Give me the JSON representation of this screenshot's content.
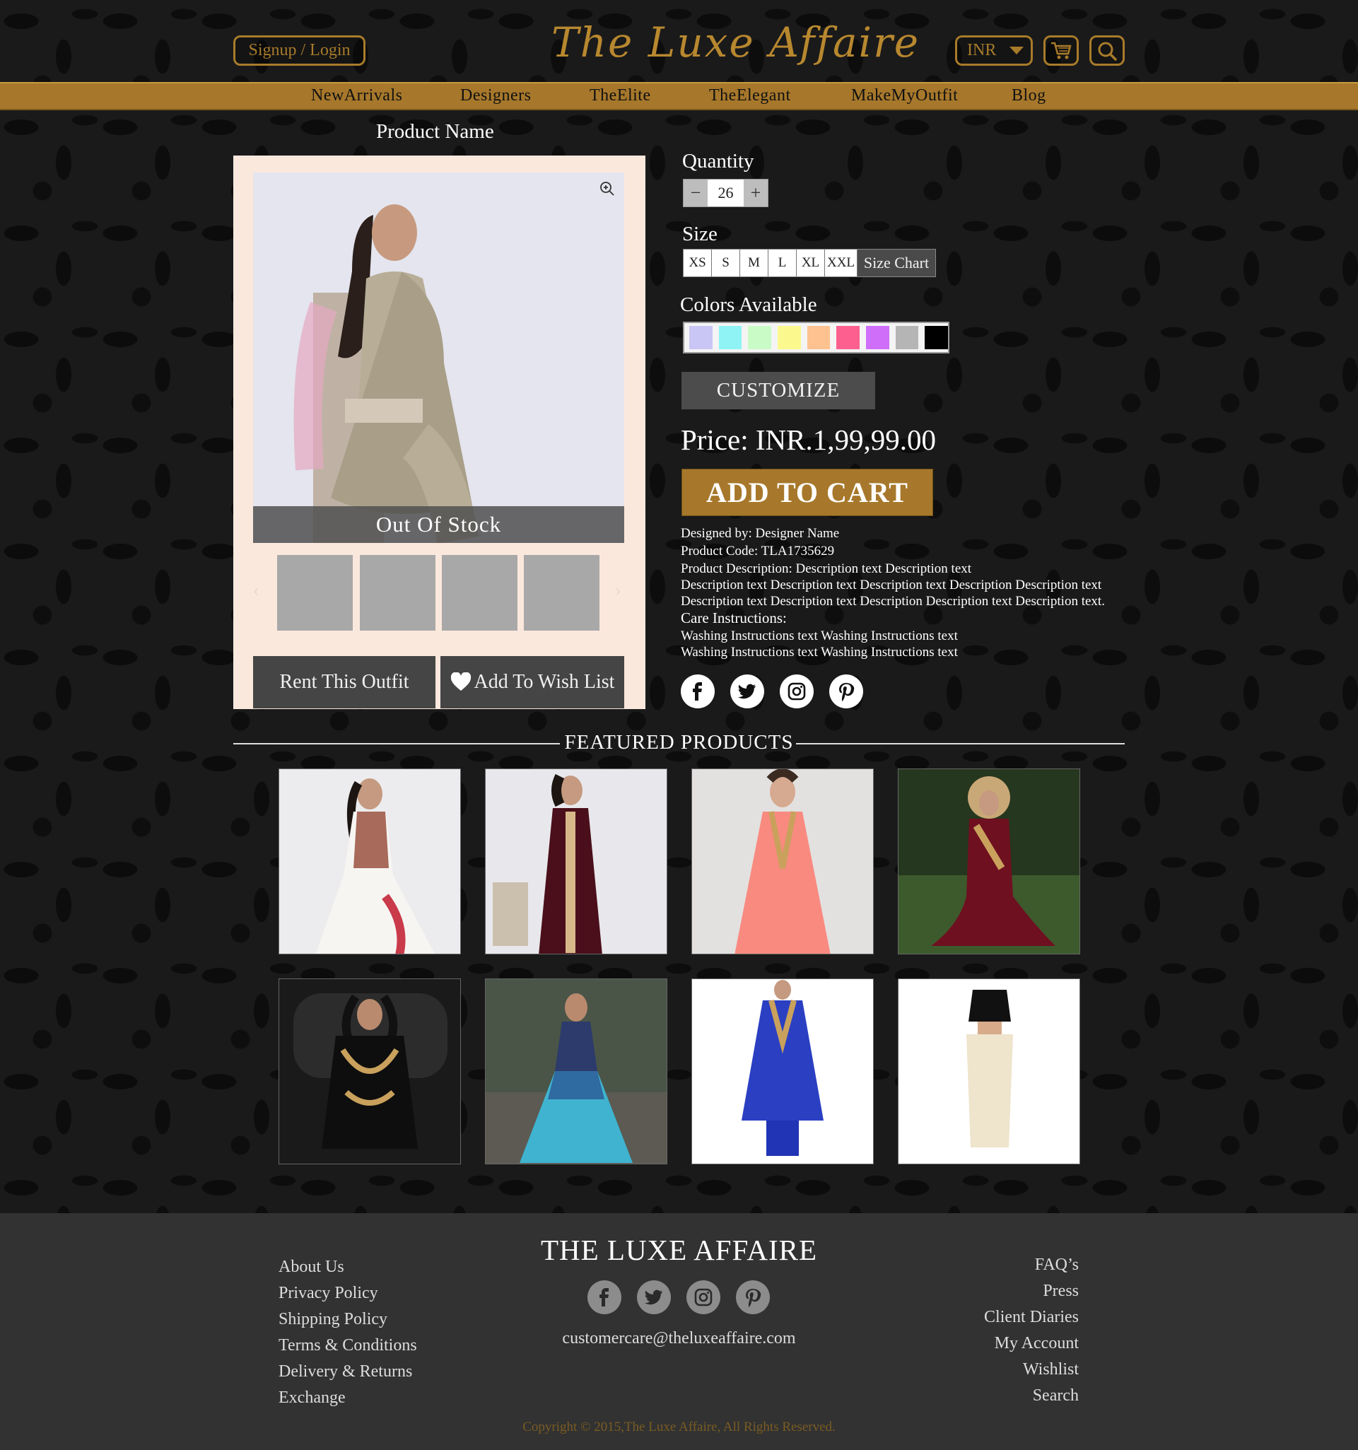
{
  "header": {
    "signup_label": "Signup / Login",
    "logo_text": "The Luxe Affaire",
    "currency": "INR"
  },
  "nav": [
    "NewArrivals",
    "Designers",
    "TheElite",
    "TheElegant",
    "MakeMyOutfit",
    "Blog"
  ],
  "product": {
    "name": "Product Name",
    "stock_status": "Out Of Stock",
    "rent_label": "Rent This Outfit",
    "wishlist_label": "Add To Wish List",
    "quantity_label": "Quantity",
    "quantity_value": "26",
    "size_label": "Size",
    "sizes": [
      "XS",
      "S",
      "M",
      "L",
      "XL",
      "XXL"
    ],
    "size_chart_label": "Size Chart",
    "colors_label": "Colors Available",
    "colors": [
      "#c9c5f5",
      "#8ff3f6",
      "#c9fbc7",
      "#fbf98d",
      "#fdc28f",
      "#fd5f8f",
      "#cf6ff9",
      "#b5b5b5",
      "#000000"
    ],
    "customize_label": "CUSTOMIZE",
    "price": "Price: INR.1,99,99.00",
    "add_to_cart_label": "ADD TO CART",
    "designed_by": "Designed by:  Designer Name",
    "product_code": "Product Code: TLA1735629",
    "description_1": "Product Description: Description text Description text",
    "description_2": "Description text Description text Description text Description Description text",
    "description_3": "Description text Description text Description Description text Description text.",
    "care_label": "Care Instructions:",
    "care_1": "Washing Instructions text Washing Instructions text",
    "care_2": "Washing Instructions text Washing Instructions text"
  },
  "featured_title": "FEATURED PRODUCTS",
  "footer": {
    "brand": "THE LUXE AFFAIRE",
    "email": "customercare@theluxeaffaire.com",
    "left_links": [
      "About Us",
      "Privacy Policy",
      "Shipping Policy",
      "Terms & Conditions",
      "Delivery & Returns",
      "Exchange"
    ],
    "right_links": [
      "FAQ’s",
      "Press",
      "Client Diaries",
      "My Account",
      "Wishlist",
      "Search"
    ],
    "copyright": "Copyright © 2015,The Luxe Affaire, All Rights Reserved."
  },
  "colors": {
    "gold": "#a7782b",
    "footer_bg": "#323232",
    "panel_bg": "#fbe8dd"
  },
  "icons": [
    "zoom-icon",
    "cart-icon",
    "search-icon",
    "chevron-down-icon",
    "heart-icon",
    "facebook-icon",
    "twitter-icon",
    "instagram-icon",
    "pinterest-icon"
  ]
}
